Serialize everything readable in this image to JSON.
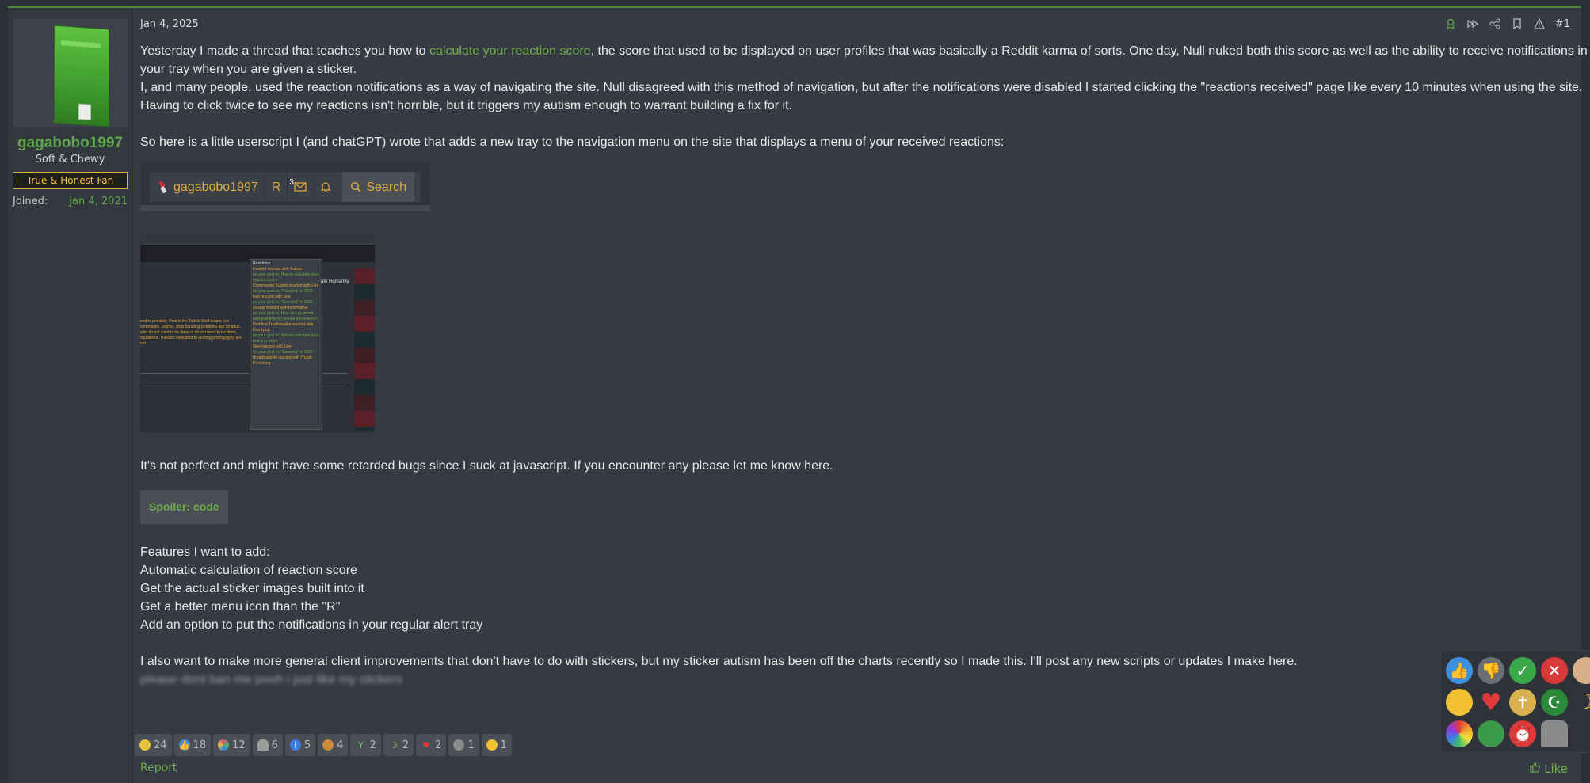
{
  "user": {
    "username": "gagabobo1997",
    "title": "Soft & Chewy",
    "banner": "True & Honest Fan",
    "joined_label": "Joined:",
    "joined_value": "Jan 4, 2021"
  },
  "post": {
    "date": "Jan 4, 2025",
    "number": "#1",
    "para1_pre": "Yesterday I made a thread that teaches you how to ",
    "para1_link": "calculate your reaction score",
    "para1_post": ", the score that used to be displayed on user profiles that was basically a Reddit karma of sorts. One day, Null nuked both this score as well as the ability to receive notifications in your tray when you are given a sticker.",
    "para2": "I, and many people, used the reaction notifications as a way of navigating the site. Null disagreed with this method of navigation, but after the notifications were disabled I started clicking the \"reactions received\" page like every 10 minutes when using the site. Having to click twice to see my reactions isn't horrible, but it triggers my autism enough to warrant building a fix for it.",
    "para3": "So here is a little userscript I (and chatGPT) wrote that adds a new tray to the navigation menu on the site that displays a menu of your received reactions:",
    "para4": "It's not perfect and might have some retarded bugs since I suck at javascript. If you encounter any please let me know here.",
    "spoiler_label": "Spoiler: code",
    "features_heading": "Features I want to add:",
    "features": [
      "Automatic calculation of reaction score",
      "Get the actual sticker images built into it",
      "Get a better menu icon than the \"R\"",
      "Add an option to put the notifications in your regular alert tray"
    ],
    "para5": "I also want to make more general client improvements that don't have to do with stickers, but my sticker autism has been off the charts recently so I made this. I'll post any new scripts or updates I make here.",
    "blurred_line": "please dont ban me pooh i just like my stickers"
  },
  "nav_preview": {
    "username": "gagabobo1997",
    "r_label": "R",
    "badge": "3",
    "search_label": "Search"
  },
  "screenshot": {
    "menu_title": "Reactions",
    "items": [
      "Hooked reacted with Autistic",
      "on your post in: How to calculate your reaction score",
      "Commander Scarlet reacted with Like",
      "on your post in: \"Gooning\" in 2025",
      "Null reacted with Like",
      "on your post in: \"Gooning\" in 2025",
      "Shokai reacted with Informative",
      "on your post in: How do I go about safeguarding my private information?",
      "Hardline Traditionalist reacted with Horrifying",
      "on your post in: How to calculate your reaction score",
      "Skel reacted with Like",
      "on your post in: \"Gooning\" in 2025",
      "Breadbandski reacted with Thunk-Provoking"
    ],
    "left_text": "ended privately. Post in the Talk to Staff board, use community. Scarlet, Stop handling problems like an adult. who do not want to be there or do not need to be there, squatered. Threads dedicated to sharing pornography are not",
    "header_fragment": "ate Humanity."
  },
  "reactions": [
    {
      "icon": "gold-coin-icon",
      "count": "24",
      "color": "#e7c23b"
    },
    {
      "icon": "thumbs-up-icon",
      "count": "18",
      "color": "#3f8fe0"
    },
    {
      "icon": "pinwheel-icon",
      "count": "12",
      "color": "#d64a7a"
    },
    {
      "icon": "tombstone-icon",
      "count": "6",
      "color": "#9b9b9b"
    },
    {
      "icon": "info-icon",
      "count": "5",
      "color": "#3a7fe0"
    },
    {
      "icon": "graduate-icon",
      "count": "4",
      "color": "#c98a3a"
    },
    {
      "icon": "cocktail-icon",
      "count": "2",
      "color": "#6fcf6a"
    },
    {
      "icon": "moon-icon",
      "count": "2",
      "color": "#f0c84a"
    },
    {
      "icon": "heart-icon",
      "count": "2",
      "color": "#e03a3a"
    },
    {
      "icon": "dislike-icon",
      "count": "1",
      "color": "#8a8a8a"
    },
    {
      "icon": "thinking-icon",
      "count": "1",
      "color": "#f0c030"
    }
  ],
  "footer": {
    "report": "Report",
    "like": "Like"
  },
  "colors": {
    "accent_green": "#6faf4a",
    "username_green": "#5ea84a",
    "banner_gold": "#f2c24a",
    "nav_orange": "#e0a93b"
  }
}
